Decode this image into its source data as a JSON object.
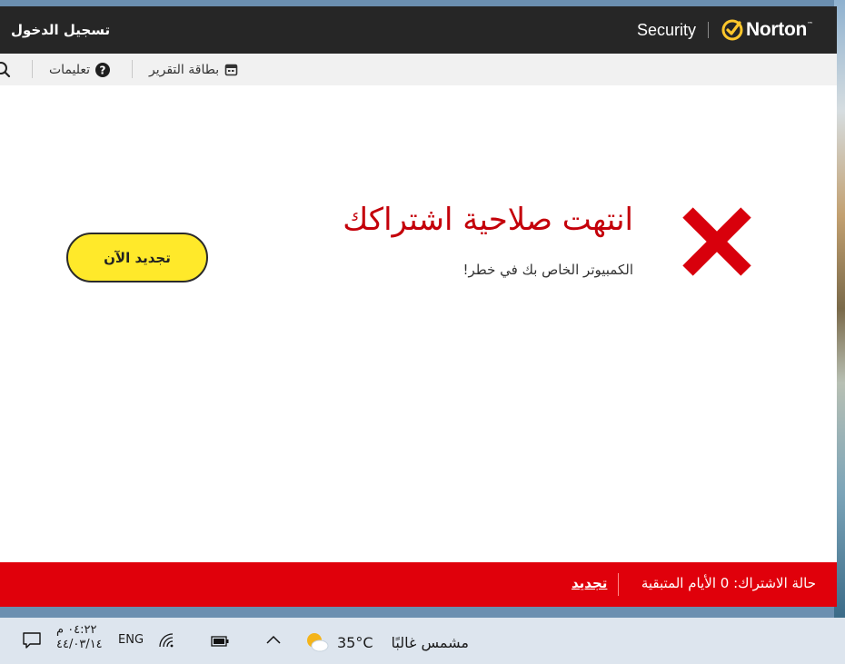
{
  "window": {
    "login_label": "تسجيل الدخول",
    "brand": {
      "product": "Security",
      "name": "Norton",
      "tm": "™"
    }
  },
  "toolbar": {
    "report_card": "بطاقة التقرير",
    "help": "تعليمات"
  },
  "main": {
    "headline": "انتهت صلاحية اشتراكك",
    "subtext": "الكمبيوتر الخاص بك في خطر!",
    "renew_button": "تجديد الآن"
  },
  "status_bar": {
    "subscription_status": "حالة الاشتراك: 0 الأيام المتبقية",
    "renew_link": "تجديد"
  },
  "taskbar": {
    "weather_temp": "35°C",
    "weather_desc": "مشمس غالبًا",
    "language": "ENG",
    "time": "٠٤:٢٢ م",
    "date": "٤٤/٠٣/١٤"
  },
  "colors": {
    "titlebar": "#262626",
    "norton_yellow": "#ffc72c",
    "alert_red": "#c4000a",
    "status_red": "#e0000b",
    "button_yellow": "#ffe92a"
  }
}
